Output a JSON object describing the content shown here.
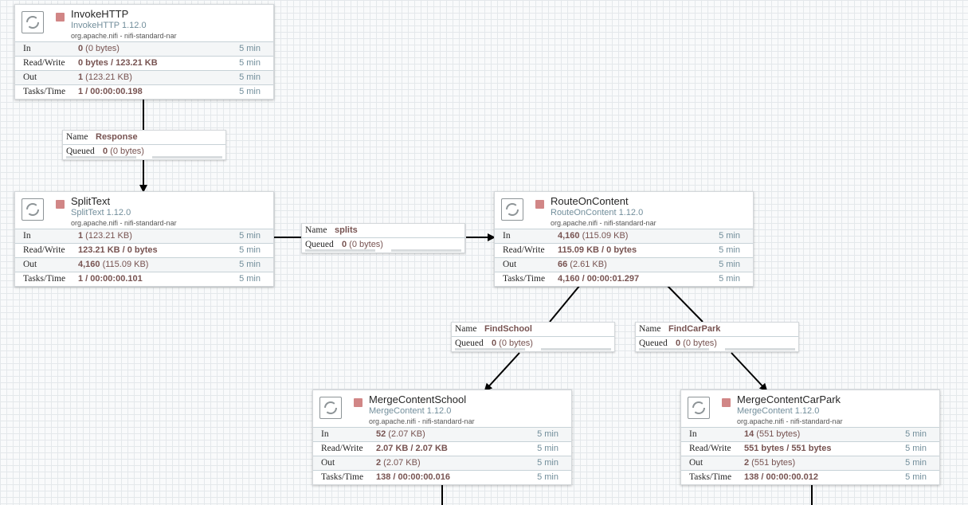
{
  "processors": [
    {
      "id": "invokehttp",
      "name": "InvokeHTTP",
      "type": "InvokeHTTP 1.12.0",
      "bundle": "org.apache.nifi - nifi-standard-nar",
      "stats": {
        "in": {
          "label": "In",
          "main": "0",
          "sub": " (0 bytes)",
          "period": "5 min"
        },
        "rw": {
          "label": "Read/Write",
          "main": "0 bytes / 123.21 KB",
          "period": "5 min"
        },
        "out": {
          "label": "Out",
          "main": "1",
          "sub": " (123.21 KB)",
          "period": "5 min"
        },
        "tasks": {
          "label": "Tasks/Time",
          "main": "1 / 00:00:00.198",
          "period": "5 min"
        }
      }
    },
    {
      "id": "splittext",
      "name": "SplitText",
      "type": "SplitText 1.12.0",
      "bundle": "org.apache.nifi - nifi-standard-nar",
      "stats": {
        "in": {
          "label": "In",
          "main": "1",
          "sub": " (123.21 KB)",
          "period": "5 min"
        },
        "rw": {
          "label": "Read/Write",
          "main": "123.21 KB / 0 bytes",
          "period": "5 min"
        },
        "out": {
          "label": "Out",
          "main": "4,160",
          "sub": " (115.09 KB)",
          "period": "5 min"
        },
        "tasks": {
          "label": "Tasks/Time",
          "main": "1 / 00:00:00.101",
          "period": "5 min"
        }
      }
    },
    {
      "id": "routeoncontent",
      "name": "RouteOnContent",
      "type": "RouteOnContent 1.12.0",
      "bundle": "org.apache.nifi - nifi-standard-nar",
      "stats": {
        "in": {
          "label": "In",
          "main": "4,160",
          "sub": " (115.09 KB)",
          "period": "5 min"
        },
        "rw": {
          "label": "Read/Write",
          "main": "115.09 KB / 0 bytes",
          "period": "5 min"
        },
        "out": {
          "label": "Out",
          "main": "66",
          "sub": " (2.61 KB)",
          "period": "5 min"
        },
        "tasks": {
          "label": "Tasks/Time",
          "main": "4,160 / 00:00:01.297",
          "period": "5 min"
        }
      }
    },
    {
      "id": "mergeschool",
      "name": "MergeContentSchool",
      "type": "MergeContent 1.12.0",
      "bundle": "org.apache.nifi - nifi-standard-nar",
      "stats": {
        "in": {
          "label": "In",
          "main": "52",
          "sub": " (2.07 KB)",
          "period": "5 min"
        },
        "rw": {
          "label": "Read/Write",
          "main": "2.07 KB / 2.07 KB",
          "period": "5 min"
        },
        "out": {
          "label": "Out",
          "main": "2",
          "sub": " (2.07 KB)",
          "period": "5 min"
        },
        "tasks": {
          "label": "Tasks/Time",
          "main": "138 / 00:00:00.016",
          "period": "5 min"
        }
      }
    },
    {
      "id": "mergecarpark",
      "name": "MergeContentCarPark",
      "type": "MergeContent 1.12.0",
      "bundle": "org.apache.nifi - nifi-standard-nar",
      "stats": {
        "in": {
          "label": "In",
          "main": "14",
          "sub": " (551 bytes)",
          "period": "5 min"
        },
        "rw": {
          "label": "Read/Write",
          "main": "551 bytes / 551 bytes",
          "period": "5 min"
        },
        "out": {
          "label": "Out",
          "main": "2",
          "sub": " (551 bytes)",
          "period": "5 min"
        },
        "tasks": {
          "label": "Tasks/Time",
          "main": "138 / 00:00:00.012",
          "period": "5 min"
        }
      }
    }
  ],
  "connections": [
    {
      "id": "response",
      "name_label": "Name",
      "name": "Response",
      "queued_label": "Queued",
      "queued_count": "0",
      "queued_size": " (0 bytes)"
    },
    {
      "id": "splits",
      "name_label": "Name",
      "name": "splits",
      "queued_label": "Queued",
      "queued_count": "0",
      "queued_size": " (0 bytes)"
    },
    {
      "id": "findschool",
      "name_label": "Name",
      "name": "FindSchool",
      "queued_label": "Queued",
      "queued_count": "0",
      "queued_size": " (0 bytes)"
    },
    {
      "id": "findcarpark",
      "name_label": "Name",
      "name": "FindCarPark",
      "queued_label": "Queued",
      "queued_count": "0",
      "queued_size": " (0 bytes)"
    }
  ],
  "icons": {
    "processor": "processor-icon",
    "stopped": "stopped-icon"
  },
  "colors": {
    "stopped": "#d18686",
    "value": "#775351",
    "muted": "#728e9b",
    "canvas": "#f9fafb"
  }
}
